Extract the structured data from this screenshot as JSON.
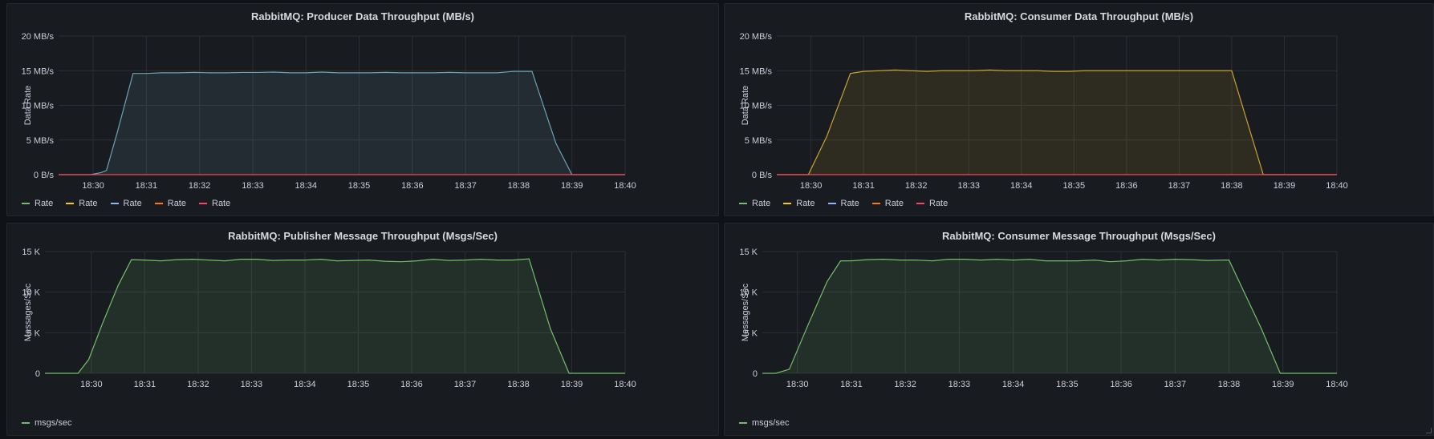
{
  "panels": [
    {
      "id": "producer-data",
      "title": "RabbitMQ: Producer Data Throughput (MB/s)",
      "ylabel": "Data Rate",
      "legend": [
        {
          "name": "Rate",
          "color": "#73bf69"
        },
        {
          "name": "Rate",
          "color": "#f2cc0c"
        },
        {
          "name": "Rate",
          "color": "#8ab8ff"
        },
        {
          "name": "Rate",
          "color": "#ff780a"
        },
        {
          "name": "Rate",
          "color": "#f2495c"
        }
      ]
    },
    {
      "id": "consumer-data",
      "title": "RabbitMQ: Consumer Data Throughput (MB/s)",
      "ylabel": "Data Rate",
      "legend": [
        {
          "name": "Rate",
          "color": "#73bf69"
        },
        {
          "name": "Rate",
          "color": "#f2cc0c"
        },
        {
          "name": "Rate",
          "color": "#8ab8ff"
        },
        {
          "name": "Rate",
          "color": "#ff780a"
        },
        {
          "name": "Rate",
          "color": "#f2495c"
        }
      ]
    },
    {
      "id": "publisher-msgs",
      "title": "RabbitMQ: Publisher Message Throughput (Msgs/Sec)",
      "ylabel": "Messages/Sec",
      "legend": [
        {
          "name": "msgs/sec",
          "color": "#73bf69"
        }
      ]
    },
    {
      "id": "consumer-msgs",
      "title": "RabbitMQ: Consumer Message Throughput (Msgs/Sec)",
      "ylabel": "Messages/Sec",
      "legend": [
        {
          "name": "msgs/sec",
          "color": "#73bf69"
        }
      ]
    }
  ],
  "chart_data": [
    {
      "type": "area",
      "title": "RabbitMQ: Producer Data Throughput (MB/s)",
      "ylabel": "Data Rate",
      "xticks": [
        "18:30",
        "18:31",
        "18:32",
        "18:33",
        "18:34",
        "18:35",
        "18:36",
        "18:37",
        "18:38",
        "18:39",
        "18:40"
      ],
      "yticks": [
        "0 B/s",
        "5 MB/s",
        "10 MB/s",
        "15 MB/s",
        "20 MB/s"
      ],
      "xlim": [
        29.35,
        40.0
      ],
      "ylim": [
        0,
        20
      ],
      "grid": true,
      "legend_position": "bottom-left",
      "series": [
        {
          "color": "#6ba4b5",
          "fill": true,
          "x": [
            29.35,
            29.65,
            29.95,
            30.15,
            30.25,
            30.45,
            30.75,
            31.0,
            31.3,
            31.6,
            31.9,
            32.2,
            32.5,
            32.8,
            33.1,
            33.4,
            33.7,
            34.0,
            34.3,
            34.6,
            34.9,
            35.2,
            35.5,
            35.8,
            36.1,
            36.4,
            36.7,
            37.0,
            37.3,
            37.6,
            37.9,
            38.25,
            38.7,
            39.0,
            40.0
          ],
          "y": [
            0,
            0,
            0,
            0.3,
            0.6,
            6.0,
            14.6,
            14.6,
            14.7,
            14.7,
            14.75,
            14.7,
            14.7,
            14.75,
            14.75,
            14.8,
            14.7,
            14.7,
            14.8,
            14.7,
            14.7,
            14.7,
            14.75,
            14.7,
            14.7,
            14.7,
            14.75,
            14.7,
            14.7,
            14.7,
            14.9,
            14.9,
            4.5,
            0,
            0
          ]
        },
        {
          "color": "#f2495c",
          "fill": false,
          "x": [
            29.35,
            40.0
          ],
          "y": [
            0,
            0
          ]
        }
      ]
    },
    {
      "type": "area",
      "title": "RabbitMQ: Consumer Data Throughput (MB/s)",
      "ylabel": "Data Rate",
      "xticks": [
        "18:30",
        "18:31",
        "18:32",
        "18:33",
        "18:34",
        "18:35",
        "18:36",
        "18:37",
        "18:38",
        "18:39",
        "18:40"
      ],
      "yticks": [
        "0 B/s",
        "5 MB/s",
        "10 MB/s",
        "15 MB/s",
        "20 MB/s"
      ],
      "xlim": [
        29.35,
        40.0
      ],
      "ylim": [
        0,
        20
      ],
      "grid": true,
      "legend_position": "bottom-left",
      "series": [
        {
          "color": "#c8a32e",
          "fill": true,
          "x": [
            29.35,
            29.6,
            29.95,
            30.3,
            30.75,
            31.0,
            31.3,
            31.6,
            31.9,
            32.2,
            32.5,
            32.8,
            33.1,
            33.4,
            33.7,
            34.0,
            34.3,
            34.6,
            34.9,
            35.2,
            35.5,
            35.8,
            36.1,
            36.4,
            36.7,
            37.0,
            37.3,
            37.6,
            37.9,
            38.0,
            38.6,
            39.0,
            40.0
          ],
          "y": [
            0,
            0,
            0,
            5.5,
            14.6,
            14.9,
            15.0,
            15.1,
            15.0,
            14.9,
            15.0,
            15.0,
            15.0,
            15.1,
            15.0,
            15.0,
            15.0,
            14.9,
            14.9,
            15.0,
            15.0,
            15.0,
            15.0,
            15.0,
            15.0,
            15.0,
            15.0,
            15.0,
            15.0,
            15.0,
            0,
            0,
            0
          ]
        },
        {
          "color": "#f2495c",
          "fill": false,
          "x": [
            29.35,
            40.0
          ],
          "y": [
            0,
            0
          ]
        }
      ]
    },
    {
      "type": "area",
      "title": "RabbitMQ: Publisher Message Throughput (Msgs/Sec)",
      "ylabel": "Messages/Sec",
      "xticks": [
        "18:30",
        "18:31",
        "18:32",
        "18:33",
        "18:34",
        "18:35",
        "18:36",
        "18:37",
        "18:38",
        "18:39",
        "18:40"
      ],
      "yticks": [
        "0",
        "5 K",
        "10 K",
        "15 K"
      ],
      "xlim": [
        29.13,
        40.0
      ],
      "ylim": [
        0,
        15
      ],
      "grid": true,
      "legend_position": "bottom-left",
      "series": [
        {
          "color": "#73bf69",
          "fill": true,
          "x": [
            29.13,
            29.4,
            29.75,
            29.95,
            30.2,
            30.5,
            30.75,
            31.0,
            31.3,
            31.6,
            31.9,
            32.2,
            32.5,
            32.8,
            33.1,
            33.4,
            33.7,
            34.0,
            34.3,
            34.6,
            34.9,
            35.2,
            35.5,
            35.8,
            36.1,
            36.4,
            36.7,
            37.0,
            37.3,
            37.6,
            37.9,
            38.2,
            38.6,
            38.95,
            40.0
          ],
          "y": [
            0,
            0,
            0,
            1.7,
            6.0,
            10.8,
            14.0,
            13.95,
            13.85,
            14.0,
            14.05,
            13.95,
            13.85,
            14.05,
            14.05,
            13.9,
            13.95,
            13.95,
            14.05,
            13.85,
            13.9,
            13.95,
            13.8,
            13.75,
            13.85,
            14.05,
            13.9,
            13.95,
            14.05,
            13.95,
            13.95,
            14.1,
            5.5,
            0,
            0
          ]
        }
      ]
    },
    {
      "type": "area",
      "title": "RabbitMQ: Consumer Message Throughput (Msgs/Sec)",
      "ylabel": "Messages/Sec",
      "xticks": [
        "18:30",
        "18:31",
        "18:32",
        "18:33",
        "18:34",
        "18:35",
        "18:36",
        "18:37",
        "18:38",
        "18:39",
        "18:40"
      ],
      "yticks": [
        "0",
        "5 K",
        "10 K",
        "15 K"
      ],
      "xlim": [
        29.35,
        40.0
      ],
      "ylim": [
        0,
        15
      ],
      "grid": true,
      "legend_position": "bottom-left",
      "series": [
        {
          "color": "#73bf69",
          "fill": true,
          "x": [
            29.35,
            29.6,
            29.85,
            30.2,
            30.55,
            30.8,
            31.0,
            31.3,
            31.6,
            31.9,
            32.2,
            32.5,
            32.8,
            33.1,
            33.4,
            33.7,
            34.0,
            34.3,
            34.6,
            34.9,
            35.2,
            35.5,
            35.8,
            36.1,
            36.4,
            36.7,
            37.0,
            37.3,
            37.6,
            37.9,
            38.0,
            38.6,
            38.95,
            40.0
          ],
          "y": [
            0,
            0,
            0.5,
            6.0,
            11.3,
            13.85,
            13.85,
            14.0,
            14.05,
            13.95,
            13.95,
            13.85,
            14.05,
            14.05,
            13.95,
            14.05,
            13.95,
            14.05,
            13.85,
            13.85,
            13.85,
            13.95,
            13.75,
            13.85,
            14.05,
            13.95,
            14.05,
            14.0,
            13.9,
            13.95,
            13.95,
            5.5,
            0,
            0
          ]
        }
      ]
    }
  ]
}
